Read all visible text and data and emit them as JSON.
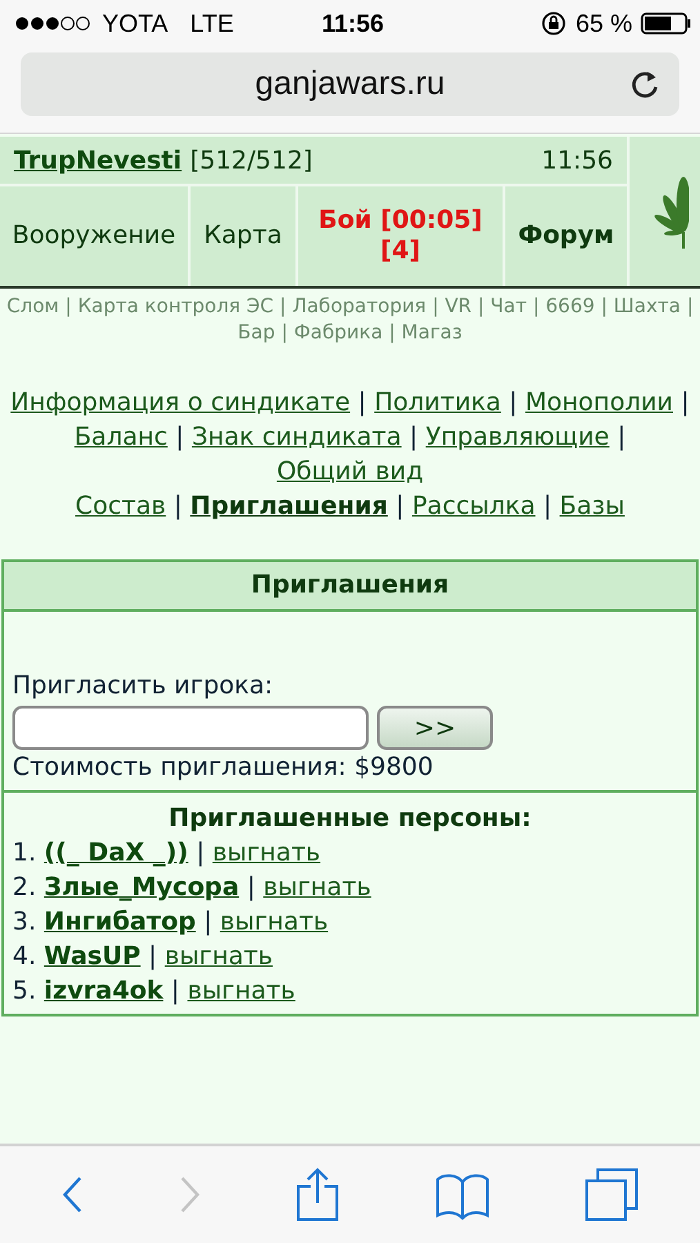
{
  "status_bar": {
    "carrier": "YOTA",
    "network": "LTE",
    "time": "11:56",
    "battery": "65 %"
  },
  "address_bar": {
    "url": "ganjawars.ru"
  },
  "header": {
    "player": "TrupNevesti",
    "hp": "[512/512]",
    "time": "11:56",
    "menu": [
      {
        "label": "Вооружение",
        "kind": "plain"
      },
      {
        "label": "Карта",
        "kind": "plain"
      },
      {
        "label": "Бой [00:05] [4]",
        "kind": "alert"
      },
      {
        "label": "Форум",
        "kind": "bold"
      }
    ]
  },
  "quick_links": {
    "separator": "|",
    "items": [
      "Слом",
      "Карта контроля ЭС",
      "Лаборатория",
      "VR",
      "Чат",
      "6669",
      "Шахта",
      "Бар",
      "Фабрика",
      "Магаз"
    ]
  },
  "syndicate_nav": {
    "separator": "|",
    "groups": [
      [
        {
          "label": "Информация о синдикате",
          "selected": false
        },
        {
          "label": "Политика",
          "selected": false
        },
        {
          "label": "Монополии",
          "selected": false
        },
        {
          "label": "Баланс",
          "selected": false
        },
        {
          "label": "Знак синдиката",
          "selected": false
        },
        {
          "label": "Управляющие",
          "selected": false
        },
        {
          "label": "Общий вид",
          "selected": false
        }
      ],
      [
        {
          "label": "Состав",
          "selected": false
        },
        {
          "label": "Приглашения",
          "selected": true
        },
        {
          "label": "Рассылка",
          "selected": false
        },
        {
          "label": "Базы",
          "selected": false
        }
      ]
    ]
  },
  "panel": {
    "title": "Приглашения",
    "invite_label": "Пригласить игрока:",
    "submit": ">>",
    "cost": "Стоимость приглашения: $9800",
    "list_title": "Приглашенные персоны:",
    "members": [
      {
        "number": "1.",
        "name": "((_ DaX _))",
        "action": "выгнать"
      },
      {
        "number": "2.",
        "name": "Злые_Мусора",
        "action": "выгнать"
      },
      {
        "number": "3.",
        "name": "Ингибатор",
        "action": "выгнать"
      },
      {
        "number": "4.",
        "name": "WasUP",
        "action": "выгнать"
      },
      {
        "number": "5.",
        "name": "izvra4ok",
        "action": "выгнать"
      }
    ]
  },
  "toolbar": {
    "back_disabled": false,
    "forward_disabled": true
  }
}
